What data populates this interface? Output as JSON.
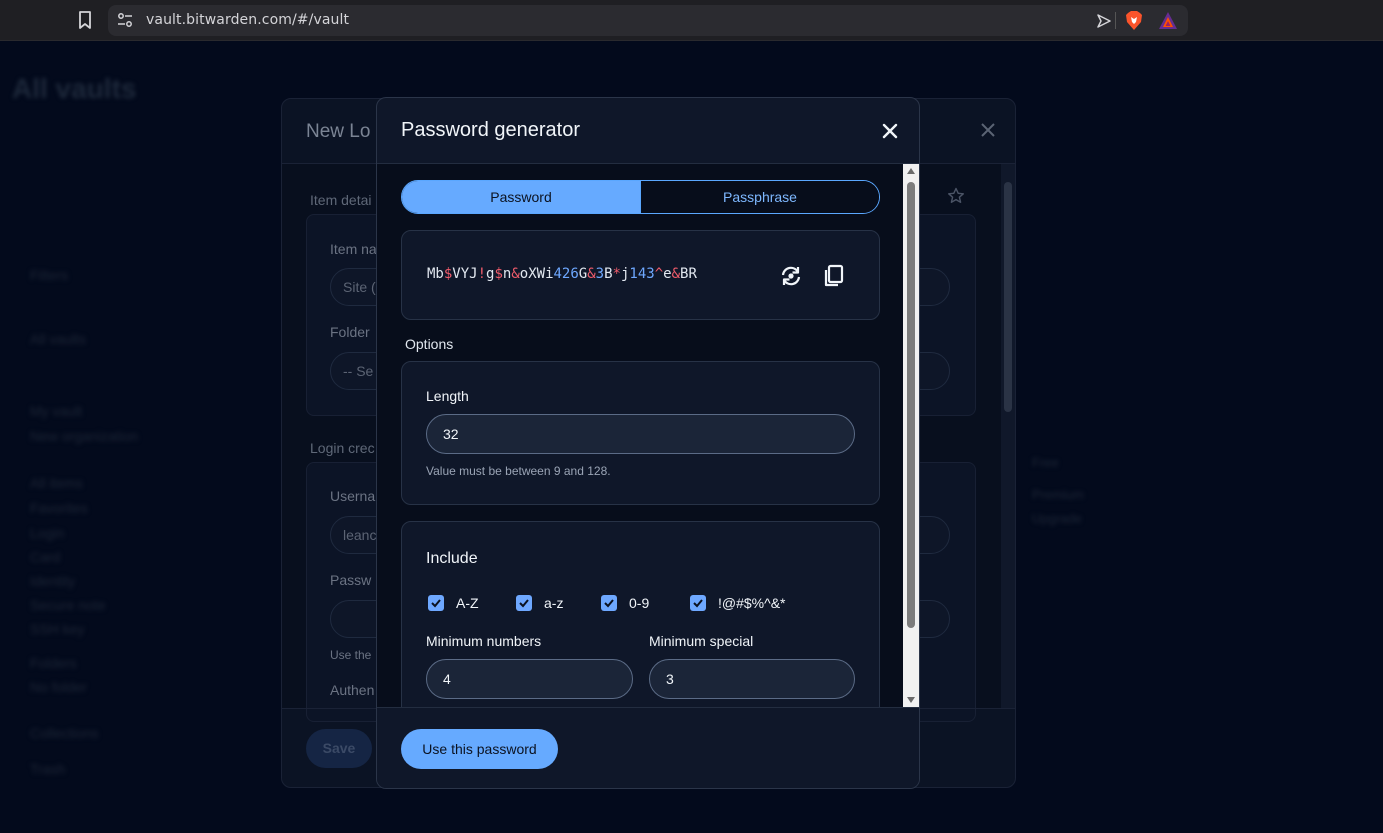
{
  "browser": {
    "url": "vault.bitwarden.com/#/vault"
  },
  "background": {
    "title": "All vaults",
    "sidebar": [
      "Filters",
      "All vaults",
      "My vault",
      "New organization",
      "All items",
      "Favorites",
      "Login",
      "Card",
      "Identity",
      "Secure note",
      "SSH key",
      "Folders",
      "No folder",
      "Collections",
      "Trash"
    ],
    "right": [
      "Free",
      "Premium",
      "Upgrade"
    ]
  },
  "underlying_dialog": {
    "title": "New Lo",
    "sections": [
      "Item detai",
      "Login crec"
    ],
    "labels": [
      "Item na",
      "Folder",
      "Userna",
      "Passw",
      "Authen"
    ],
    "inputs": [
      "Site (",
      "-- Se",
      "leanc",
      ""
    ],
    "hint": "Use the",
    "save": "Save"
  },
  "modal": {
    "title": "Password generator",
    "tabs": {
      "password": "Password",
      "passphrase": "Passphrase"
    },
    "password_parts": [
      [
        "Mb",
        "c"
      ],
      [
        "$",
        "s"
      ],
      [
        "VYJ",
        "c"
      ],
      [
        "!",
        "s"
      ],
      [
        "g",
        "c"
      ],
      [
        "$",
        "s"
      ],
      [
        "n",
        "c"
      ],
      [
        "&",
        "s"
      ],
      [
        "oXWi",
        "c"
      ],
      [
        "426",
        "n"
      ],
      [
        "G",
        "c"
      ],
      [
        "&",
        "s"
      ],
      [
        "3",
        "n"
      ],
      [
        "B",
        "c"
      ],
      [
        "*",
        "s"
      ],
      [
        "j",
        "c"
      ],
      [
        "143",
        "n"
      ],
      [
        "^",
        "s"
      ],
      [
        "e",
        "c"
      ],
      [
        "&",
        "s"
      ],
      [
        "BR",
        "c"
      ]
    ],
    "options_title": "Options",
    "length": {
      "label": "Length",
      "value": "32",
      "hint": "Value must be between 9 and 128."
    },
    "include": {
      "title": "Include",
      "checkboxes": [
        {
          "label": "A-Z",
          "checked": true
        },
        {
          "label": "a-z",
          "checked": true
        },
        {
          "label": "0-9",
          "checked": true
        },
        {
          "label": "!@#$%^&*",
          "checked": true
        }
      ]
    },
    "min_numbers": {
      "label": "Minimum numbers",
      "value": "4"
    },
    "min_special": {
      "label": "Minimum special",
      "value": "3"
    },
    "use_button": "Use this password"
  }
}
